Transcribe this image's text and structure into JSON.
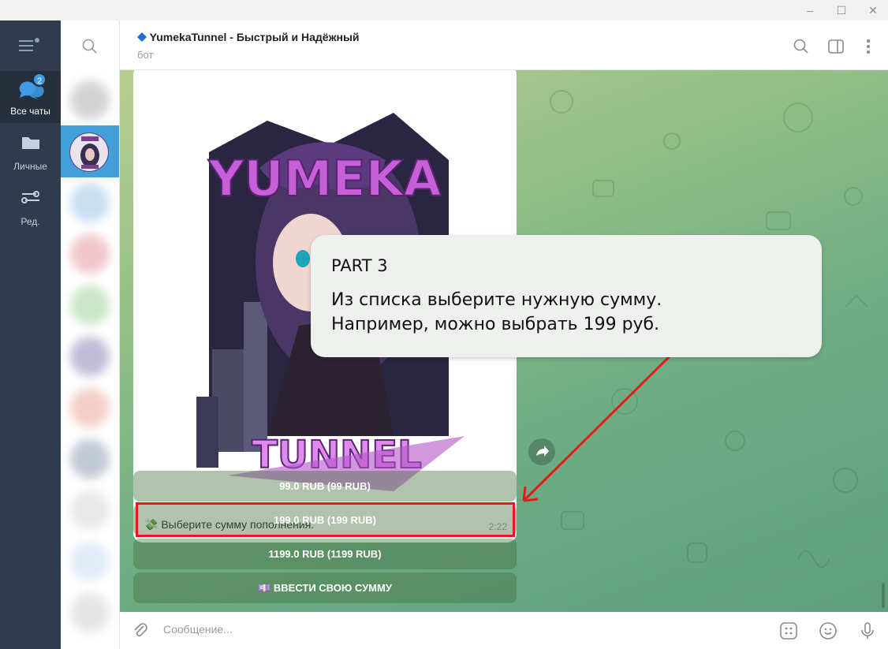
{
  "window": {
    "minimize_icon": "minimize-icon",
    "maximize_icon": "maximize-icon",
    "close_icon": "close-icon"
  },
  "rail": {
    "items": [
      {
        "label": "Все чаты",
        "icon": "chats-icon",
        "badge": "2",
        "active": true
      },
      {
        "label": "Личные",
        "icon": "folder-icon",
        "active": false
      },
      {
        "label": "Ред.",
        "icon": "edit-filters-icon",
        "active": false
      }
    ]
  },
  "chat": {
    "title": "YumekaTunnel - Быстрый и Надёжный",
    "subtitle": "бот",
    "accent_color": "#419fd9"
  },
  "message": {
    "image_title_top": "YUMEKA",
    "image_title_bottom": "TUNNEL",
    "text": "💸 Выберите сумму пополнения:",
    "time": "2:22"
  },
  "keyboard": {
    "buttons": [
      {
        "label": "99.0 RUB (99 RUB)"
      },
      {
        "label": "199.0 RUB (199 RUB)",
        "highlighted": true
      },
      {
        "label": "1199.0 RUB (1199 RUB)"
      },
      {
        "label": "💷 ВВЕСТИ СВОЮ СУММУ"
      }
    ]
  },
  "callout": {
    "part": "PART  3",
    "line1": "Из списка выберите нужную сумму.",
    "line2": "Например, можно выбрать 199 руб."
  },
  "composer": {
    "placeholder": "Сообщение..."
  },
  "colors": {
    "rail_bg": "#2f3c4d",
    "highlight": "#e51b1b",
    "keyboard_button": "#6a9a5e"
  }
}
